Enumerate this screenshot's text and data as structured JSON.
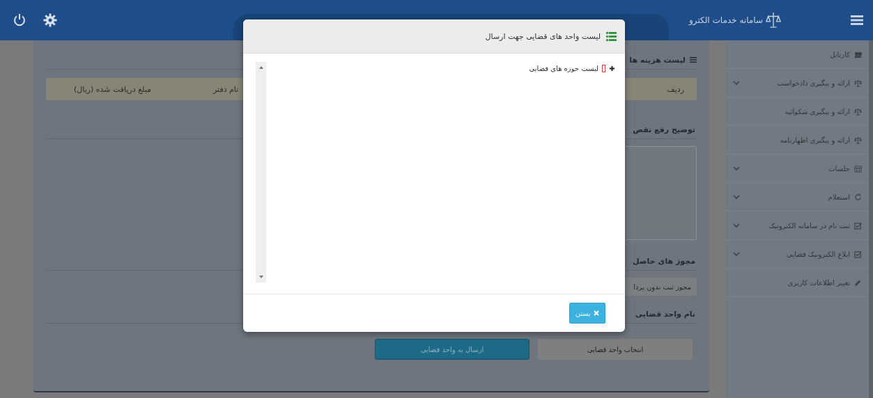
{
  "header": {
    "title": "سامانه خدمات الکترو"
  },
  "sidebar": {
    "items": [
      {
        "label": "کارتابل",
        "kind": "dashboard",
        "has_submenu": false
      },
      {
        "label": "ارائه و پیگیری دادخواست",
        "kind": "scales",
        "has_submenu": true
      },
      {
        "label": "ارائه و پیگیری شکوائیه",
        "kind": "scales",
        "has_submenu": false
      },
      {
        "label": "ارائه و پیگیری اظهارنامه",
        "kind": "scales",
        "has_submenu": false
      },
      {
        "label": "جلسات",
        "kind": "calendar",
        "has_submenu": true
      },
      {
        "label": "استعلام",
        "kind": "refresh",
        "has_submenu": true
      },
      {
        "label": "ثبت نام در سامانه الکترونیک",
        "kind": "check",
        "has_submenu": true
      },
      {
        "label": "ابلاغ الکترونیک قضایی",
        "kind": "check",
        "has_submenu": true
      },
      {
        "label": "تغییر اطلاعات کاربری",
        "kind": "pencil",
        "has_submenu": false
      }
    ]
  },
  "main": {
    "costs_heading": "لیست هزینه ها",
    "table": {
      "columns": [
        "ردیف",
        "نام دفتر",
        "مبلغ دریافت شده (ریال)"
      ]
    },
    "defect_heading": "توضیح رفع نقص",
    "permits_heading": "مجوز های حاصل",
    "permit_field": "مجوز ثبت بدون پردا",
    "unit_heading": "نام واحد قضایی",
    "buttons": [
      {
        "label": "انتخاب واحد قضایی",
        "kind": "select"
      },
      {
        "label": "ارسال به واحد قضایی",
        "kind": "send"
      }
    ]
  },
  "modal": {
    "title": "لیست واحد های قضایی جهت ارسال",
    "tree": [
      {
        "label": "لیست حوزه های قضایی",
        "expanded": false,
        "checked": false
      }
    ],
    "close_button": "بستن"
  }
}
